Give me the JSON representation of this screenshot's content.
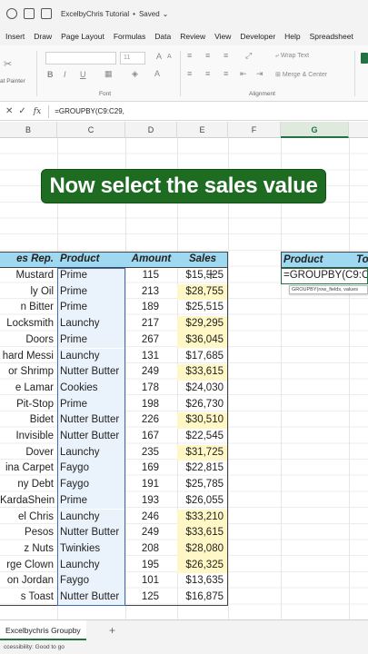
{
  "titlebar": {
    "title": "ExcelbyChris Tutorial",
    "separator": "•",
    "status": "Saved",
    "chevron": "⌄"
  },
  "ribbon_tabs": [
    "Insert",
    "Draw",
    "Page Layout",
    "Formulas",
    "Data",
    "Review",
    "View",
    "Developer",
    "Help",
    "Spreadsheet"
  ],
  "ribbon": {
    "paste_label": "at Painter",
    "font_group_label": "Font",
    "alignment_group_label": "Alignment",
    "wrap_text_label": "Wrap Text",
    "merge_label": "Merge & Center",
    "font_size_value": "11"
  },
  "formula_bar": {
    "cancel": "✕",
    "enter": "✓",
    "fx": "fx",
    "formula": "=GROUPBY(C9:C29,"
  },
  "columns": [
    "B",
    "C",
    "D",
    "E",
    "F",
    "G"
  ],
  "banner_text": "Now select the sales value",
  "table": {
    "headers": {
      "rep": "es Rep.",
      "product": "Product",
      "amount": "Amount",
      "sales": "Sales"
    },
    "rows": [
      {
        "rep": "Mustard",
        "product": "Prime",
        "amount": "115",
        "sales": "$15,525",
        "highlight": false
      },
      {
        "rep": "ly Oil",
        "product": "Prime",
        "amount": "213",
        "sales": "$28,755",
        "highlight": true
      },
      {
        "rep": "n Bitter",
        "product": "Prime",
        "amount": "189",
        "sales": "$25,515",
        "highlight": false
      },
      {
        "rep": "Locksmith",
        "product": "Launchy",
        "amount": "217",
        "sales": "$29,295",
        "highlight": true
      },
      {
        "rep": "Doors",
        "product": "Prime",
        "amount": "267",
        "sales": "$36,045",
        "highlight": true
      },
      {
        "rep": "hard Messi",
        "product": "Launchy",
        "amount": "131",
        "sales": "$17,685",
        "highlight": false
      },
      {
        "rep": "or Shrimp",
        "product": "Nutter Butter",
        "amount": "249",
        "sales": "$33,615",
        "highlight": true
      },
      {
        "rep": "e Lamar",
        "product": "Cookies",
        "amount": "178",
        "sales": "$24,030",
        "highlight": false
      },
      {
        "rep": "Pit-Stop",
        "product": "Prime",
        "amount": "198",
        "sales": "$26,730",
        "highlight": false
      },
      {
        "rep": "Bidet",
        "product": "Nutter Butter",
        "amount": "226",
        "sales": "$30,510",
        "highlight": true
      },
      {
        "rep": "Invisible",
        "product": "Nutter Butter",
        "amount": "167",
        "sales": "$22,545",
        "highlight": false
      },
      {
        "rep": "Dover",
        "product": "Launchy",
        "amount": "235",
        "sales": "$31,725",
        "highlight": true
      },
      {
        "rep": "ina Carpet",
        "product": "Faygo",
        "amount": "169",
        "sales": "$22,815",
        "highlight": false
      },
      {
        "rep": "ny Debt",
        "product": "Faygo",
        "amount": "191",
        "sales": "$25,785",
        "highlight": false
      },
      {
        "rep": "KardaShein",
        "product": "Prime",
        "amount": "193",
        "sales": "$26,055",
        "highlight": false
      },
      {
        "rep": "el Chris",
        "product": "Launchy",
        "amount": "246",
        "sales": "$33,210",
        "highlight": true
      },
      {
        "rep": "Pesos",
        "product": "Nutter Butter",
        "amount": "249",
        "sales": "$33,615",
        "highlight": true
      },
      {
        "rep": "z Nuts",
        "product": "Twinkies",
        "amount": "208",
        "sales": "$28,080",
        "highlight": true
      },
      {
        "rep": "rge Clown",
        "product": "Launchy",
        "amount": "195",
        "sales": "$26,325",
        "highlight": true
      },
      {
        "rep": "on Jordan",
        "product": "Faygo",
        "amount": "101",
        "sales": "$13,635",
        "highlight": false
      },
      {
        "rep": "s Toast",
        "product": "Nutter Butter",
        "amount": "125",
        "sales": "$16,875",
        "highlight": false
      }
    ]
  },
  "right_table": {
    "product_header": "Product",
    "to_header": "To",
    "formula_cell": "=GROUPBY(C9:C2",
    "tooltip": "GROUPBY(row_fields, values"
  },
  "sheet": {
    "tab_name": "Excelbychris Groupby",
    "add": "+",
    "status": "ccessibility: Good to go"
  },
  "colors": {
    "header_fill": "#9fd8f1",
    "highlight_fill": "#fff7c6",
    "banner_fill": "#1e6b22",
    "excel_green": "#217346"
  }
}
